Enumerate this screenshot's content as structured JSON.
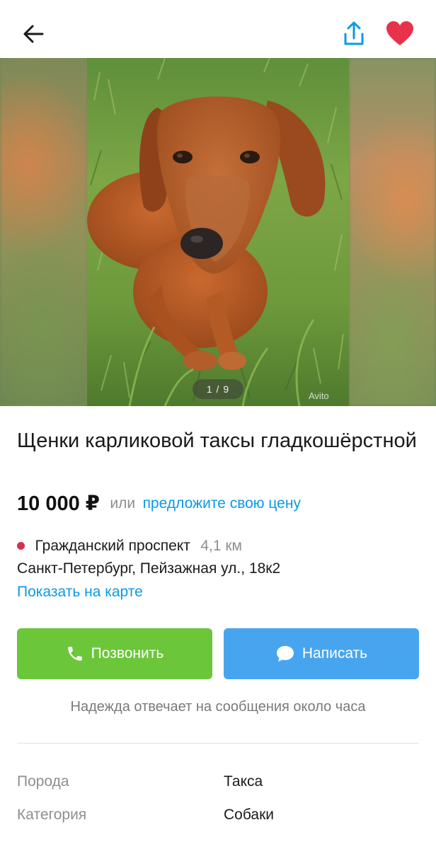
{
  "header": {
    "back_icon": "arrow-left-icon",
    "share_icon": "share-icon",
    "favorite_icon": "heart-icon",
    "favorite_color": "#e8324b",
    "share_color": "#0a9ae6"
  },
  "gallery": {
    "counter": "1 / 9",
    "current": 1,
    "total": 9,
    "watermark": "Avito"
  },
  "listing": {
    "title": "Щенки карликовой таксы гладкошёрстной",
    "price": "10 000 ₽",
    "price_or": "или",
    "offer_link": "предложите свою цену"
  },
  "location": {
    "metro": "Гражданский проспект",
    "metro_color": "#d8314b",
    "distance": "4,1 км",
    "address": "Санкт-Петербург, Пейзажная ул., 18к2",
    "map_link": "Показать на карте"
  },
  "actions": {
    "call_label": "Позвонить",
    "call_icon": "phone-icon",
    "call_color": "#6cc63a",
    "message_label": "Написать",
    "message_icon": "chat-bubble-icon",
    "message_color": "#47a5f0"
  },
  "seller_note": "Надежда отвечает на сообщения около часа",
  "params": [
    {
      "label": "Порода",
      "value": "Такса"
    },
    {
      "label": "Категория",
      "value": "Собаки"
    }
  ]
}
